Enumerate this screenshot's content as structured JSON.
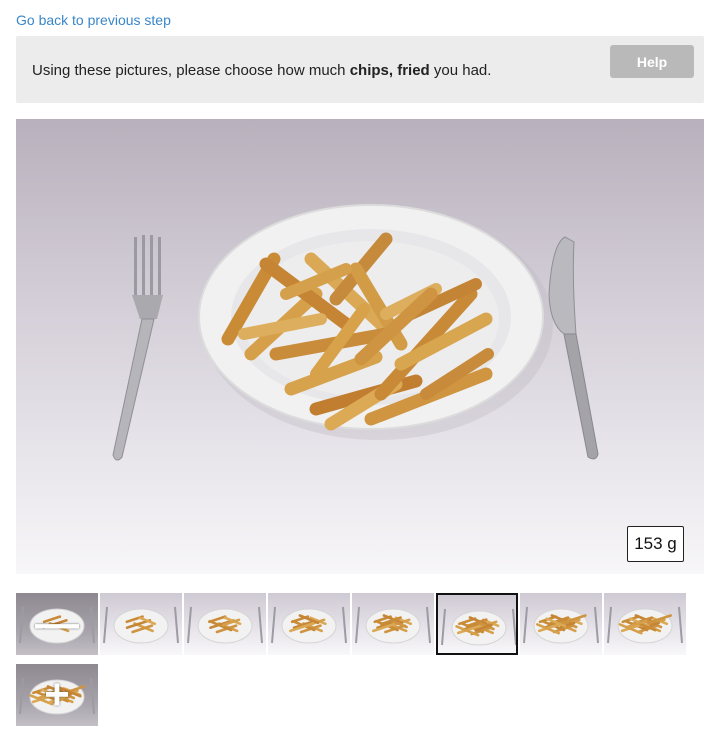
{
  "nav": {
    "back_label": "Go back to previous step"
  },
  "prompt": {
    "text_before": "Using these pictures, please choose how much ",
    "food_name": "chips, fried",
    "text_after": " you had.",
    "help_label": "Help"
  },
  "portion": {
    "weight_label": "153 g",
    "selected_index": 5
  },
  "thumbnails": [
    {
      "kind": "decrease",
      "symbol": "—",
      "icon": "minus-icon",
      "amount": 0
    },
    {
      "kind": "portion",
      "amount": 1
    },
    {
      "kind": "portion",
      "amount": 2
    },
    {
      "kind": "portion",
      "amount": 3
    },
    {
      "kind": "portion",
      "amount": 4
    },
    {
      "kind": "portion",
      "amount": 5
    },
    {
      "kind": "portion",
      "amount": 6
    },
    {
      "kind": "portion",
      "amount": 7
    },
    {
      "kind": "increase",
      "symbol": "+",
      "icon": "plus-icon",
      "amount": 8
    }
  ],
  "colors": {
    "link": "#3a86c8",
    "help_button": "#b9b9b9",
    "prompt_background": "#ececec",
    "selected_border": "#111111"
  }
}
